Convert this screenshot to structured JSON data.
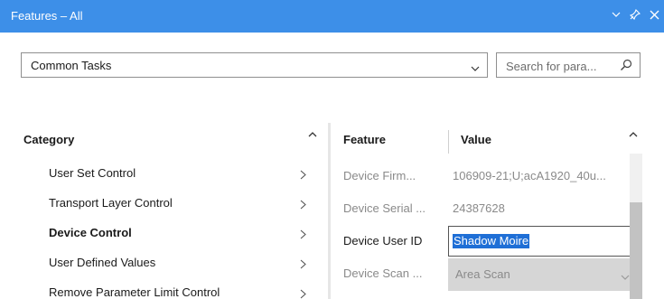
{
  "titlebar": {
    "title": "Features – All"
  },
  "toolbar": {
    "dropdown_value": "Common Tasks",
    "search_placeholder": "Search for para..."
  },
  "category_panel": {
    "header": "Category",
    "items": [
      {
        "label": "User Set Control",
        "active": false
      },
      {
        "label": "Transport Layer Control",
        "active": false
      },
      {
        "label": "Device Control",
        "active": true
      },
      {
        "label": "User Defined Values",
        "active": false
      },
      {
        "label": "Remove Parameter Limit Control",
        "active": false
      }
    ]
  },
  "feature_panel": {
    "header_feature": "Feature",
    "header_value": "Value",
    "rows": [
      {
        "feature": "Device Firm...",
        "value": "106909-21;U;acA1920_40u..."
      },
      {
        "feature": "Device Serial ...",
        "value": "24387628"
      },
      {
        "feature": "Device User ID",
        "value": "Shadow Moire"
      },
      {
        "feature": "Device Scan ...",
        "value": "Area Scan"
      }
    ]
  },
  "colors": {
    "titlebar": "#3d8fe8",
    "selection": "#1f6fd6",
    "disabled_text": "#8a8a8a"
  },
  "icons": [
    "chevron-down-icon",
    "pin-icon",
    "close-icon",
    "search-icon",
    "chevron-right-icon",
    "scroll-up-arrow-icon"
  ]
}
